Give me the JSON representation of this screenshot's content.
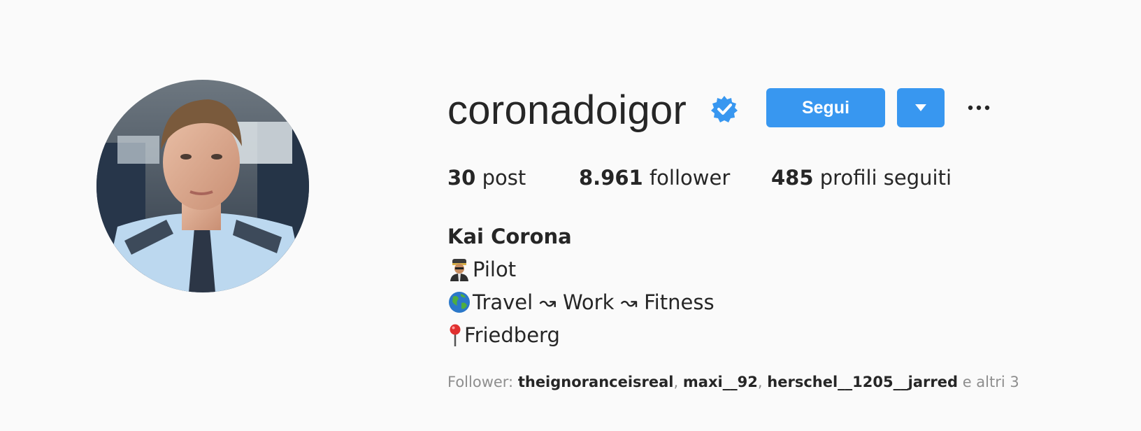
{
  "profile": {
    "username": "coronadoigor",
    "verified": true,
    "full_name": "Kai Corona",
    "avatar_icon": "profile-photo"
  },
  "actions": {
    "follow_label": "Segui",
    "dropdown_icon": "caret-down-icon",
    "more_icon": "ellipsis-icon"
  },
  "stats": {
    "posts_count": "30",
    "posts_label": "post",
    "followers_count": "8.961",
    "followers_label": "follower",
    "following_count": "485",
    "following_label": "profili seguiti"
  },
  "bio": {
    "lines": [
      {
        "icon": "pilot-emoji-icon",
        "text": " Pilot"
      },
      {
        "icon": "globe-emoji-icon",
        "text": "Travel ↝ Work ↝ Fitness"
      },
      {
        "icon": "round-pushpin-icon",
        "text": "Friedberg"
      }
    ]
  },
  "followed_by": {
    "prefix": "Follower:",
    "names": [
      "theignoranceisreal",
      "maxi__92",
      "herschel__1205__jarred"
    ],
    "separator": ",",
    "suffix": "e altri 3"
  },
  "colors": {
    "accent": "#3897f0",
    "text": "#262626",
    "muted": "#8e8e8e",
    "background": "#fafafa"
  }
}
